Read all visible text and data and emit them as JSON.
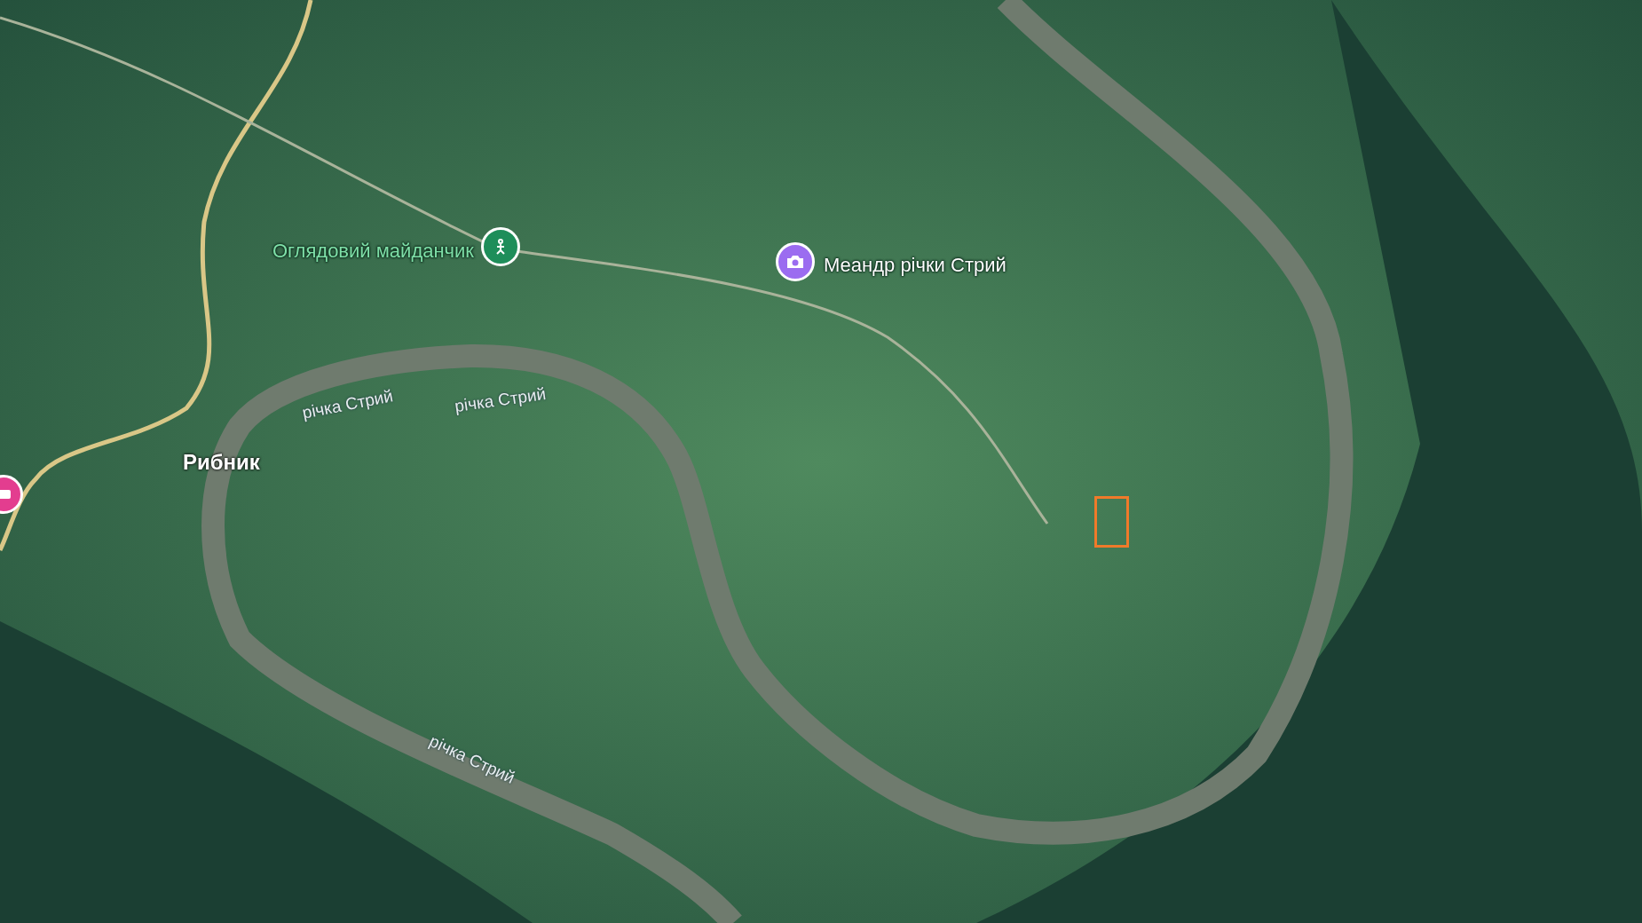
{
  "map": {
    "pins": [
      {
        "kind": "viewpoint",
        "color": "#1e8e5a",
        "label": "Оглядовий майданчик"
      },
      {
        "kind": "photo",
        "color": "#9b6cf0",
        "label": "Меандр річки Стрий"
      },
      {
        "kind": "event",
        "color": "#e33d8f"
      }
    ],
    "rivers": [
      {
        "name": "річка Стрий"
      },
      {
        "name": "річка Стрий"
      },
      {
        "name": "річка Стрий"
      }
    ],
    "towns": [
      {
        "name": "Рибник"
      }
    ]
  }
}
